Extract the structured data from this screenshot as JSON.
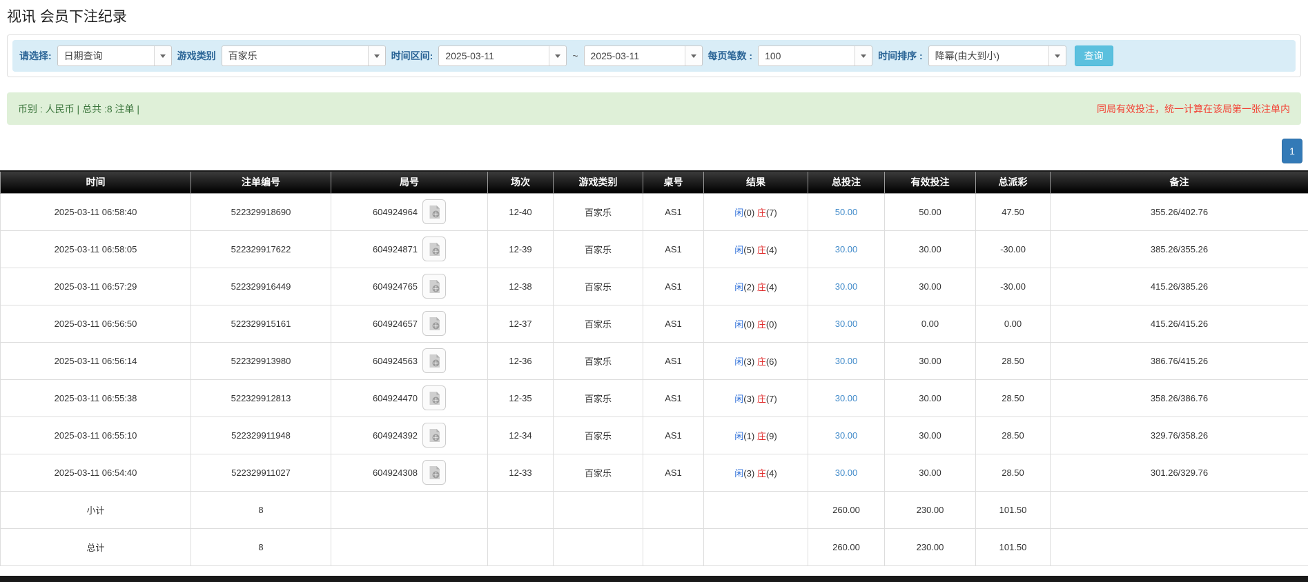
{
  "page": {
    "title": "视讯 会员下注纪录"
  },
  "filters": {
    "select_label": "请选择:",
    "select_value": "日期查询",
    "game_type_label": "游戏类别",
    "game_type_value": "百家乐",
    "time_range_label": "时间区间:",
    "date_from": "2025-03-11",
    "range_separator": "~",
    "date_to": "2025-03-11",
    "page_size_label": "每页笔数 :",
    "page_size_value": "100",
    "sort_label": "时间排序 :",
    "sort_value": "降幂(由大到小)",
    "search_button": "查询"
  },
  "notice": {
    "left": "币别 : 人民币 | 总共 :8 注单 |",
    "right": "同局有效投注，统一计算在该局第一张注单内"
  },
  "pagination": {
    "page": "1"
  },
  "table": {
    "headers": [
      "时间",
      "注单编号",
      "局号",
      "场次",
      "游戏类别",
      "桌号",
      "结果",
      "总投注",
      "有效投注",
      "总派彩",
      "备注"
    ],
    "rows": [
      {
        "time": "2025-03-11 06:58:40",
        "bet_no": "522329918690",
        "round_no": "604924964",
        "session": "12-40",
        "game": "百家乐",
        "table_no": "AS1",
        "result_player": "闲",
        "result_player_num": "(0)",
        "result_banker": "庄",
        "result_banker_num": "(7)",
        "total_bet": "50.00",
        "valid_bet": "50.00",
        "payout": "47.50",
        "note": "355.26/402.76"
      },
      {
        "time": "2025-03-11 06:58:05",
        "bet_no": "522329917622",
        "round_no": "604924871",
        "session": "12-39",
        "game": "百家乐",
        "table_no": "AS1",
        "result_player": "闲",
        "result_player_num": "(5)",
        "result_banker": "庄",
        "result_banker_num": "(4)",
        "total_bet": "30.00",
        "valid_bet": "30.00",
        "payout": "-30.00",
        "note": "385.26/355.26"
      },
      {
        "time": "2025-03-11 06:57:29",
        "bet_no": "522329916449",
        "round_no": "604924765",
        "session": "12-38",
        "game": "百家乐",
        "table_no": "AS1",
        "result_player": "闲",
        "result_player_num": "(2)",
        "result_banker": "庄",
        "result_banker_num": "(4)",
        "total_bet": "30.00",
        "valid_bet": "30.00",
        "payout": "-30.00",
        "note": "415.26/385.26"
      },
      {
        "time": "2025-03-11 06:56:50",
        "bet_no": "522329915161",
        "round_no": "604924657",
        "session": "12-37",
        "game": "百家乐",
        "table_no": "AS1",
        "result_player": "闲",
        "result_player_num": "(0)",
        "result_banker": "庄",
        "result_banker_num": "(0)",
        "total_bet": "30.00",
        "valid_bet": "0.00",
        "payout": "0.00",
        "note": "415.26/415.26"
      },
      {
        "time": "2025-03-11 06:56:14",
        "bet_no": "522329913980",
        "round_no": "604924563",
        "session": "12-36",
        "game": "百家乐",
        "table_no": "AS1",
        "result_player": "闲",
        "result_player_num": "(3)",
        "result_banker": "庄",
        "result_banker_num": "(6)",
        "total_bet": "30.00",
        "valid_bet": "30.00",
        "payout": "28.50",
        "note": "386.76/415.26"
      },
      {
        "time": "2025-03-11 06:55:38",
        "bet_no": "522329912813",
        "round_no": "604924470",
        "session": "12-35",
        "game": "百家乐",
        "table_no": "AS1",
        "result_player": "闲",
        "result_player_num": "(3)",
        "result_banker": "庄",
        "result_banker_num": "(7)",
        "total_bet": "30.00",
        "valid_bet": "30.00",
        "payout": "28.50",
        "note": "358.26/386.76"
      },
      {
        "time": "2025-03-11 06:55:10",
        "bet_no": "522329911948",
        "round_no": "604924392",
        "session": "12-34",
        "game": "百家乐",
        "table_no": "AS1",
        "result_player": "闲",
        "result_player_num": "(1)",
        "result_banker": "庄",
        "result_banker_num": "(9)",
        "total_bet": "30.00",
        "valid_bet": "30.00",
        "payout": "28.50",
        "note": "329.76/358.26"
      },
      {
        "time": "2025-03-11 06:54:40",
        "bet_no": "522329911027",
        "round_no": "604924308",
        "session": "12-33",
        "game": "百家乐",
        "table_no": "AS1",
        "result_player": "闲",
        "result_player_num": "(3)",
        "result_banker": "庄",
        "result_banker_num": "(4)",
        "total_bet": "30.00",
        "valid_bet": "30.00",
        "payout": "28.50",
        "note": "301.26/329.76"
      }
    ],
    "subtotal": {
      "label": "小计",
      "count": "8",
      "total_bet": "260.00",
      "valid_bet": "230.00",
      "payout": "101.50"
    },
    "total": {
      "label": "总计",
      "count": "8",
      "total_bet": "260.00",
      "valid_bet": "230.00",
      "payout": "101.50"
    }
  },
  "colors": {
    "filter_bg": "#d9edf7",
    "label_blue": "#2a6496",
    "search_button_bg": "#5bc0de",
    "notice_bg": "#dff0d8",
    "notice_text_green": "#3c763d",
    "notice_warning_red": "#f34235",
    "pagination_blue": "#337ab7",
    "header_bg": "#000000",
    "link_blue": "#428bca",
    "player_blue": "#2e6fd8",
    "banker_red": "#e02b2b",
    "negative_red": "#ff0000",
    "summary_bg": "#9d9d9d"
  }
}
